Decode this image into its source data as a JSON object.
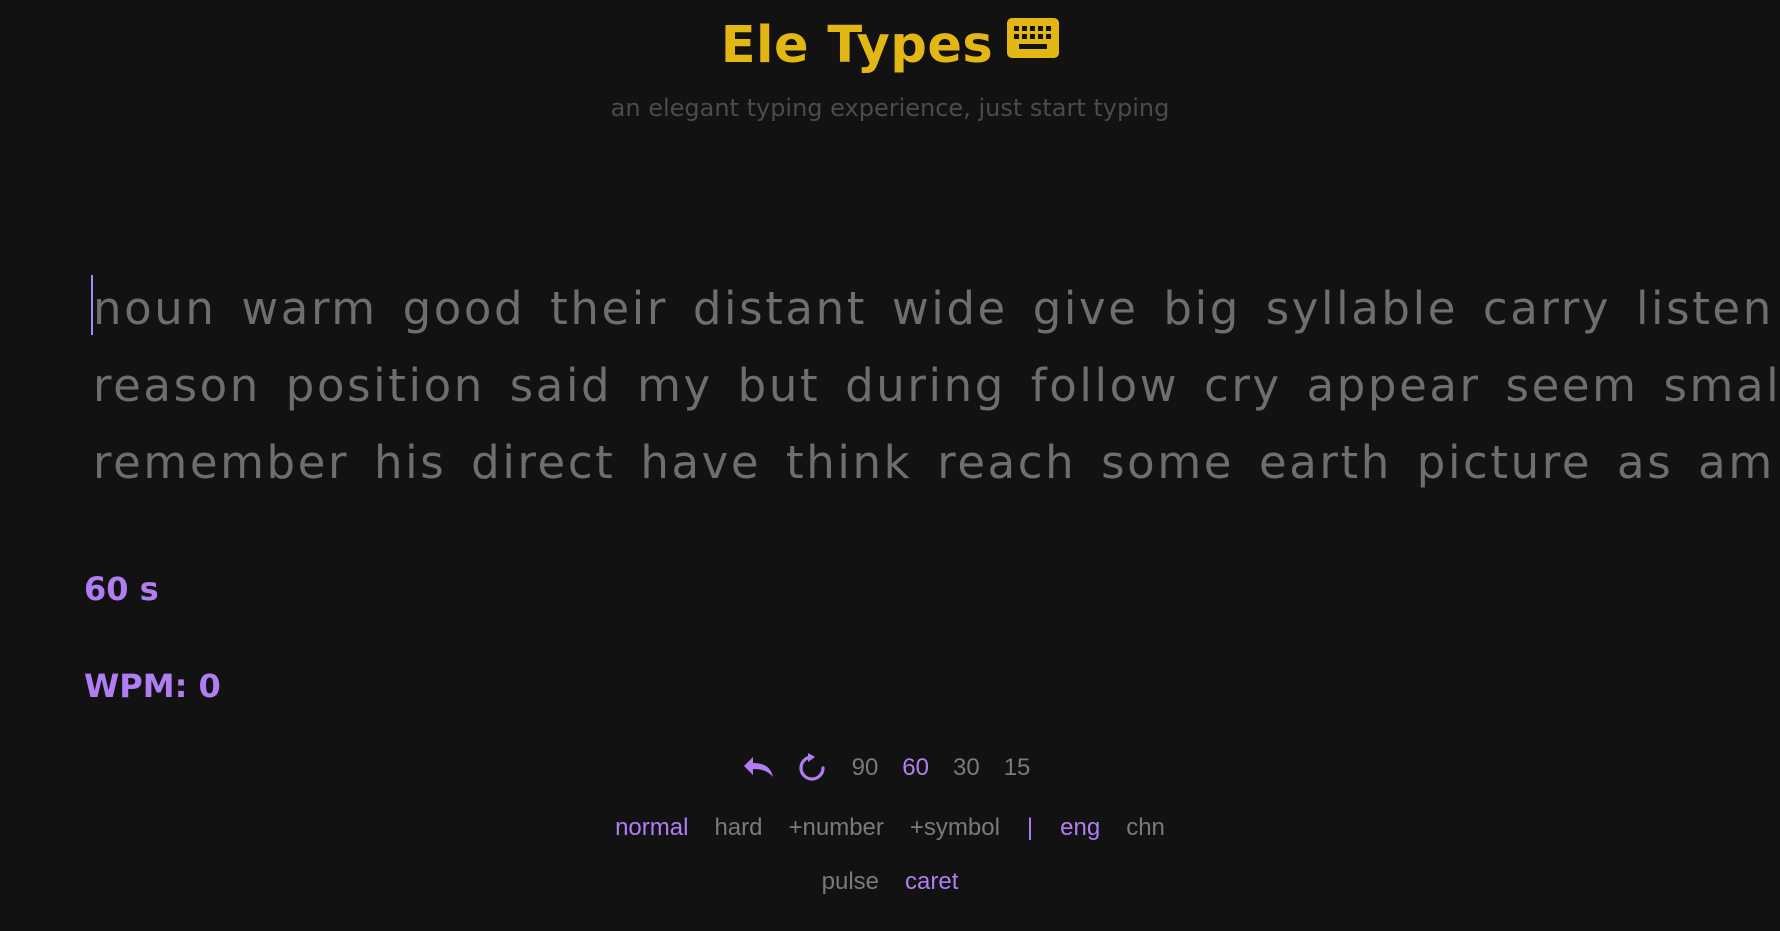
{
  "header": {
    "title": "Ele Types",
    "subtitle": "an elegant typing experience, just start typing",
    "icon": "keyboard-icon",
    "accent_color": "#e2b714"
  },
  "words": {
    "lines": [
      "noun warm good their distant wide give big syllable carry listen",
      "reason position said my but during follow cry appear seem small",
      "remember his direct have think reach some earth picture as am"
    ],
    "text_color": "#6e6e6e"
  },
  "stats": {
    "timer": "60 s",
    "wpm": "WPM: 0",
    "accent_color": "#b07ef2"
  },
  "controls": {
    "undo_icon": "undo-icon",
    "restart_icon": "restart-icon",
    "durations": [
      "90",
      "60",
      "30",
      "15"
    ],
    "selected_duration": "60",
    "difficulty": [
      "normal",
      "hard",
      "+number",
      "+symbol"
    ],
    "selected_difficulty": "normal",
    "separator": "|",
    "languages": [
      "eng",
      "chn"
    ],
    "selected_language": "eng",
    "caret_styles": [
      "pulse",
      "caret"
    ],
    "selected_caret_style": "caret"
  }
}
